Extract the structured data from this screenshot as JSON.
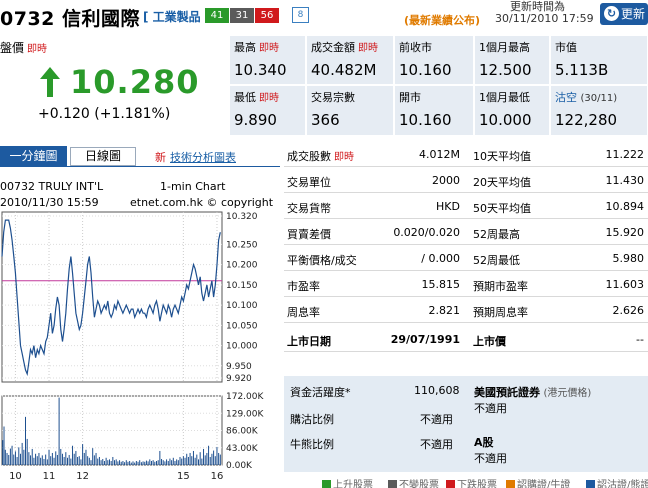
{
  "header": {
    "title": "0732 信利國際",
    "industry": "[ 工業製品 ]",
    "badges": [
      "41",
      "31",
      "56"
    ],
    "badge_extra": "8",
    "update_label": "更新時間為",
    "latest_notice": "(最新業績公布)",
    "update_time": "30/11/2010 17:59",
    "refresh_label": "更新",
    "colors": {
      "accent": "#1d5aa0",
      "up": "#2a9a2a",
      "down": "#d0191c",
      "notice": "#e07b00"
    }
  },
  "quote": {
    "nominal_label": "盤價",
    "realtime_tag": "即時",
    "last_price": "10.280",
    "change": "+0.120 (+1.181%)",
    "trend_icon": "up-arrow-icon",
    "cells": [
      {
        "label": "最高",
        "rt": "即時",
        "value": "10.340"
      },
      {
        "label": "成交金額",
        "rt": "即時",
        "value": "40.482M"
      },
      {
        "label": "前收市",
        "rt": "",
        "value": "10.160"
      },
      {
        "label": "1個月最高",
        "rt": "",
        "value": "12.500"
      },
      {
        "label": "市值",
        "rt": "",
        "value": "5.113B"
      },
      {
        "label": "最低",
        "rt": "即時",
        "value": "9.890"
      },
      {
        "label": "交易宗數",
        "rt": "",
        "value": "366"
      },
      {
        "label": "開市",
        "rt": "",
        "value": "10.160"
      },
      {
        "label": "1個月最低",
        "rt": "",
        "value": "10.000"
      },
      {
        "label": "沽空",
        "rt": "(30/11)",
        "value": "122,280"
      }
    ]
  },
  "chart_tabs": {
    "minute": "一分鐘圖",
    "daily": "日線圖",
    "new_tag": "新",
    "ta_link": "技術分析圖表"
  },
  "chart_info": {
    "line1": "00732 TRULY INT'L",
    "type": "1-min Chart",
    "line2": "2010/11/30 15:59",
    "source": "etnet.com.hk © copyright"
  },
  "chart_data": {
    "type": "line",
    "price_ticks": [
      "10.320",
      "10.250",
      "10.200",
      "10.150",
      "10.100",
      "10.050",
      "10.000",
      "9.950",
      "9.920"
    ],
    "price_tick_values": [
      10.32,
      10.25,
      10.2,
      10.15,
      10.1,
      10.05,
      10.0,
      9.95,
      9.92
    ],
    "volume_ticks": [
      "172.00K",
      "129.00K",
      "86.00K",
      "43.00K",
      "0.00K"
    ],
    "volume_tick_values": [
      172,
      129,
      86,
      43,
      0
    ],
    "x_ticks": [
      "10",
      "11",
      "12",
      "15",
      "16"
    ],
    "x_tick_values": [
      10,
      11,
      12,
      15,
      16
    ],
    "xlim": [
      9.6,
      16.15
    ],
    "ylim": [
      9.91,
      10.33
    ],
    "volume_ylim": [
      0,
      172
    ],
    "prev_close": 10.16,
    "price_series": [
      [
        9.6,
        10.22
      ],
      [
        9.65,
        10.28
      ],
      [
        9.7,
        10.31
      ],
      [
        9.8,
        10.31
      ],
      [
        9.85,
        10.29
      ],
      [
        9.9,
        10.26
      ],
      [
        9.95,
        10.22
      ],
      [
        10.0,
        10.18
      ],
      [
        10.05,
        10.12
      ],
      [
        10.1,
        10.06
      ],
      [
        10.15,
        10.0
      ],
      [
        10.2,
        9.98
      ],
      [
        10.25,
        9.96
      ],
      [
        10.3,
        9.94
      ],
      [
        10.35,
        9.93
      ],
      [
        10.4,
        9.96
      ],
      [
        10.45,
        9.99
      ],
      [
        10.5,
        9.98
      ],
      [
        10.55,
        10.0
      ],
      [
        10.6,
        9.97
      ],
      [
        10.65,
        9.99
      ],
      [
        10.7,
        9.98
      ],
      [
        10.75,
        10.0
      ],
      [
        10.8,
        9.99
      ],
      [
        10.85,
        9.98
      ],
      [
        10.9,
        10.01
      ],
      [
        10.95,
        10.02
      ],
      [
        11.0,
        10.05
      ],
      [
        11.05,
        10.08
      ],
      [
        11.1,
        10.03
      ],
      [
        11.15,
        10.05
      ],
      [
        11.2,
        10.09
      ],
      [
        11.25,
        10.12
      ],
      [
        11.3,
        10.1
      ],
      [
        11.35,
        10.04
      ],
      [
        11.4,
        10.01
      ],
      [
        11.45,
        10.04
      ],
      [
        11.5,
        10.08
      ],
      [
        11.55,
        10.14
      ],
      [
        11.6,
        10.19
      ],
      [
        11.65,
        10.22
      ],
      [
        11.7,
        10.18
      ],
      [
        11.75,
        10.13
      ],
      [
        11.8,
        10.08
      ],
      [
        11.85,
        10.06
      ],
      [
        11.9,
        10.04
      ],
      [
        11.95,
        10.05
      ],
      [
        12.0,
        10.08
      ],
      [
        12.05,
        10.12
      ],
      [
        12.1,
        10.16
      ],
      [
        12.15,
        10.2
      ],
      [
        12.2,
        10.22
      ],
      [
        12.25,
        10.18
      ],
      [
        12.3,
        10.12
      ],
      [
        12.35,
        10.07
      ],
      [
        12.4,
        10.09
      ],
      [
        12.45,
        10.11
      ],
      [
        12.5,
        10.1
      ],
      [
        12.55,
        10.08
      ],
      [
        12.6,
        10.09
      ],
      [
        12.65,
        10.1
      ],
      [
        12.7,
        10.09
      ],
      [
        12.75,
        10.11
      ],
      [
        12.8,
        10.08
      ],
      [
        12.85,
        10.07
      ],
      [
        12.9,
        10.08
      ],
      [
        12.95,
        10.1
      ],
      [
        13.0,
        10.09
      ],
      [
        13.05,
        10.11
      ],
      [
        13.1,
        10.1
      ],
      [
        13.15,
        10.09
      ],
      [
        13.2,
        10.08
      ],
      [
        13.25,
        10.09
      ],
      [
        13.3,
        10.1
      ],
      [
        13.35,
        10.09
      ],
      [
        13.4,
        10.08
      ],
      [
        13.45,
        10.09
      ],
      [
        13.5,
        10.09
      ],
      [
        13.55,
        10.07
      ],
      [
        13.6,
        10.08
      ],
      [
        13.65,
        10.09
      ],
      [
        13.7,
        10.08
      ],
      [
        13.75,
        10.09
      ],
      [
        13.8,
        10.08
      ],
      [
        13.85,
        10.08
      ],
      [
        13.9,
        10.07
      ],
      [
        13.95,
        10.09
      ],
      [
        14.0,
        10.1
      ],
      [
        14.05,
        10.09
      ],
      [
        14.1,
        10.08
      ],
      [
        14.15,
        10.1
      ],
      [
        14.2,
        10.11
      ],
      [
        14.25,
        10.09
      ],
      [
        14.3,
        10.06
      ],
      [
        14.35,
        10.08
      ],
      [
        14.4,
        10.1
      ],
      [
        14.45,
        10.09
      ],
      [
        14.5,
        10.08
      ],
      [
        14.55,
        10.1
      ],
      [
        14.6,
        10.09
      ],
      [
        14.65,
        10.07
      ],
      [
        14.7,
        10.09
      ],
      [
        14.75,
        10.1
      ],
      [
        14.8,
        10.09
      ],
      [
        14.85,
        10.08
      ],
      [
        14.9,
        10.1
      ],
      [
        14.95,
        10.12
      ],
      [
        15.0,
        10.11
      ],
      [
        15.05,
        10.13
      ],
      [
        15.1,
        10.15
      ],
      [
        15.15,
        10.14
      ],
      [
        15.2,
        10.16
      ],
      [
        15.25,
        10.18
      ],
      [
        15.3,
        10.2
      ],
      [
        15.35,
        10.19
      ],
      [
        15.4,
        10.17
      ],
      [
        15.45,
        10.15
      ],
      [
        15.5,
        10.17
      ],
      [
        15.55,
        10.13
      ],
      [
        15.6,
        10.11
      ],
      [
        15.65,
        10.13
      ],
      [
        15.7,
        10.15
      ],
      [
        15.75,
        10.12
      ],
      [
        15.8,
        10.14
      ],
      [
        15.85,
        10.16
      ],
      [
        15.9,
        10.12
      ],
      [
        15.95,
        10.15
      ],
      [
        16.0,
        10.2
      ],
      [
        16.05,
        10.26
      ],
      [
        16.1,
        10.28
      ]
    ],
    "volume_series": [
      [
        9.62,
        62
      ],
      [
        9.66,
        96
      ],
      [
        9.7,
        38
      ],
      [
        9.75,
        30
      ],
      [
        9.8,
        25
      ],
      [
        9.85,
        41
      ],
      [
        9.9,
        48
      ],
      [
        9.95,
        26
      ],
      [
        10.0,
        34
      ],
      [
        10.05,
        20
      ],
      [
        10.1,
        44
      ],
      [
        10.15,
        28
      ],
      [
        10.2,
        55
      ],
      [
        10.25,
        38
      ],
      [
        10.3,
        120
      ],
      [
        10.35,
        65
      ],
      [
        10.4,
        32
      ],
      [
        10.45,
        24
      ],
      [
        10.5,
        40
      ],
      [
        10.55,
        18
      ],
      [
        10.6,
        28
      ],
      [
        10.65,
        22
      ],
      [
        10.7,
        30
      ],
      [
        10.75,
        18
      ],
      [
        10.8,
        24
      ],
      [
        10.85,
        15
      ],
      [
        10.9,
        26
      ],
      [
        10.95,
        14
      ],
      [
        11.0,
        38
      ],
      [
        11.05,
        22
      ],
      [
        11.1,
        30
      ],
      [
        11.15,
        18
      ],
      [
        11.2,
        34
      ],
      [
        11.25,
        25
      ],
      [
        11.3,
        168
      ],
      [
        11.35,
        40
      ],
      [
        11.4,
        28
      ],
      [
        11.45,
        20
      ],
      [
        11.5,
        32
      ],
      [
        11.55,
        18
      ],
      [
        11.6,
        25
      ],
      [
        11.65,
        16
      ],
      [
        11.7,
        48
      ],
      [
        11.75,
        28
      ],
      [
        11.8,
        35
      ],
      [
        11.85,
        20
      ],
      [
        11.9,
        22
      ],
      [
        11.95,
        14
      ],
      [
        12.0,
        52
      ],
      [
        12.05,
        30
      ],
      [
        12.1,
        38
      ],
      [
        12.15,
        22
      ],
      [
        12.2,
        18
      ],
      [
        12.25,
        12
      ],
      [
        12.3,
        42
      ],
      [
        12.35,
        24
      ],
      [
        12.4,
        30
      ],
      [
        12.45,
        16
      ],
      [
        12.5,
        20
      ],
      [
        12.55,
        12
      ],
      [
        12.6,
        15
      ],
      [
        12.65,
        10
      ],
      [
        12.7,
        18
      ],
      [
        12.75,
        12
      ],
      [
        12.8,
        14
      ],
      [
        12.85,
        10
      ],
      [
        12.9,
        20
      ],
      [
        12.95,
        12
      ],
      [
        13.0,
        14
      ],
      [
        13.05,
        9
      ],
      [
        13.1,
        12
      ],
      [
        13.15,
        8
      ],
      [
        13.2,
        10
      ],
      [
        13.25,
        7
      ],
      [
        13.3,
        12
      ],
      [
        13.35,
        8
      ],
      [
        13.4,
        10
      ],
      [
        13.45,
        6
      ],
      [
        13.5,
        9
      ],
      [
        13.55,
        6
      ],
      [
        13.6,
        10
      ],
      [
        13.65,
        8
      ],
      [
        13.7,
        12
      ],
      [
        13.75,
        7
      ],
      [
        13.8,
        9
      ],
      [
        13.85,
        8
      ],
      [
        13.9,
        11
      ],
      [
        13.95,
        9
      ],
      [
        14.0,
        14
      ],
      [
        14.05,
        10
      ],
      [
        14.1,
        12
      ],
      [
        14.15,
        8
      ],
      [
        14.2,
        10
      ],
      [
        14.25,
        12
      ],
      [
        14.3,
        35
      ],
      [
        14.35,
        15
      ],
      [
        14.4,
        12
      ],
      [
        14.45,
        9
      ],
      [
        14.5,
        14
      ],
      [
        14.55,
        10
      ],
      [
        14.6,
        16
      ],
      [
        14.65,
        12
      ],
      [
        14.7,
        18
      ],
      [
        14.75,
        10
      ],
      [
        14.8,
        14
      ],
      [
        14.85,
        12
      ],
      [
        14.9,
        20
      ],
      [
        14.95,
        16
      ],
      [
        15.0,
        22
      ],
      [
        15.05,
        18
      ],
      [
        15.1,
        28
      ],
      [
        15.15,
        20
      ],
      [
        15.2,
        30
      ],
      [
        15.25,
        22
      ],
      [
        15.3,
        35
      ],
      [
        15.35,
        18
      ],
      [
        15.4,
        26
      ],
      [
        15.45,
        14
      ],
      [
        15.5,
        32
      ],
      [
        15.55,
        16
      ],
      [
        15.6,
        40
      ],
      [
        15.65,
        24
      ],
      [
        15.7,
        30
      ],
      [
        15.75,
        48
      ],
      [
        15.8,
        20
      ],
      [
        15.85,
        28
      ],
      [
        15.9,
        36
      ],
      [
        15.95,
        22
      ],
      [
        16.0,
        45
      ],
      [
        16.05,
        30
      ],
      [
        16.1,
        26
      ]
    ]
  },
  "stats": [
    {
      "k1": "成交股數",
      "rt": "即時",
      "v1": "4.012M",
      "k2": "10天平均值",
      "v2": "11.222"
    },
    {
      "k1": "交易單位",
      "rt": "",
      "v1": "2000",
      "k2": "20天平均值",
      "v2": "11.430"
    },
    {
      "k1": "交易貨幣",
      "rt": "",
      "v1": "HKD",
      "k2": "50天平均值",
      "v2": "10.894"
    },
    {
      "k1": "買賣差價",
      "rt": "",
      "v1": "0.020/0.020",
      "k2": "52周最高",
      "v2": "15.920"
    },
    {
      "k1": "平衡價格/成交",
      "rt": "",
      "v1": "/ 0.000",
      "k2": "52周最低",
      "v2": "5.980"
    },
    {
      "k1": "市盈率",
      "rt": "",
      "v1": "15.815",
      "k2": "預期市盈率",
      "v2": "11.603"
    },
    {
      "k1": "周息率",
      "rt": "",
      "v1": "2.821",
      "k2": "預期周息率",
      "v2": "2.626"
    },
    {
      "k1": "上市日期",
      "rt": "",
      "v1": "29/07/1991",
      "k2": "上市價",
      "v2": "--"
    }
  ],
  "lower": {
    "activity_label": "資金活躍度*",
    "activity_value": "110,608",
    "call_put_label": "購沽比例",
    "call_put_value": "不適用",
    "bull_bear_label": "牛熊比例",
    "bull_bear_value": "不適用",
    "adr_title": "美國預託證券",
    "adr_sub": "(港元價格)",
    "adr_value": "不適用",
    "a_share_title": "A股",
    "a_share_value": "不適用"
  },
  "legend": [
    {
      "label": "上升股票",
      "color": "#2a9a2a"
    },
    {
      "label": "不變股票",
      "color": "#5a5a5a"
    },
    {
      "label": "下跌股票",
      "color": "#d0191c"
    },
    {
      "label": "認購證/牛證",
      "color": "#e07b00"
    },
    {
      "label": "認沽證/熊證",
      "color": "#1d5aa0"
    }
  ]
}
